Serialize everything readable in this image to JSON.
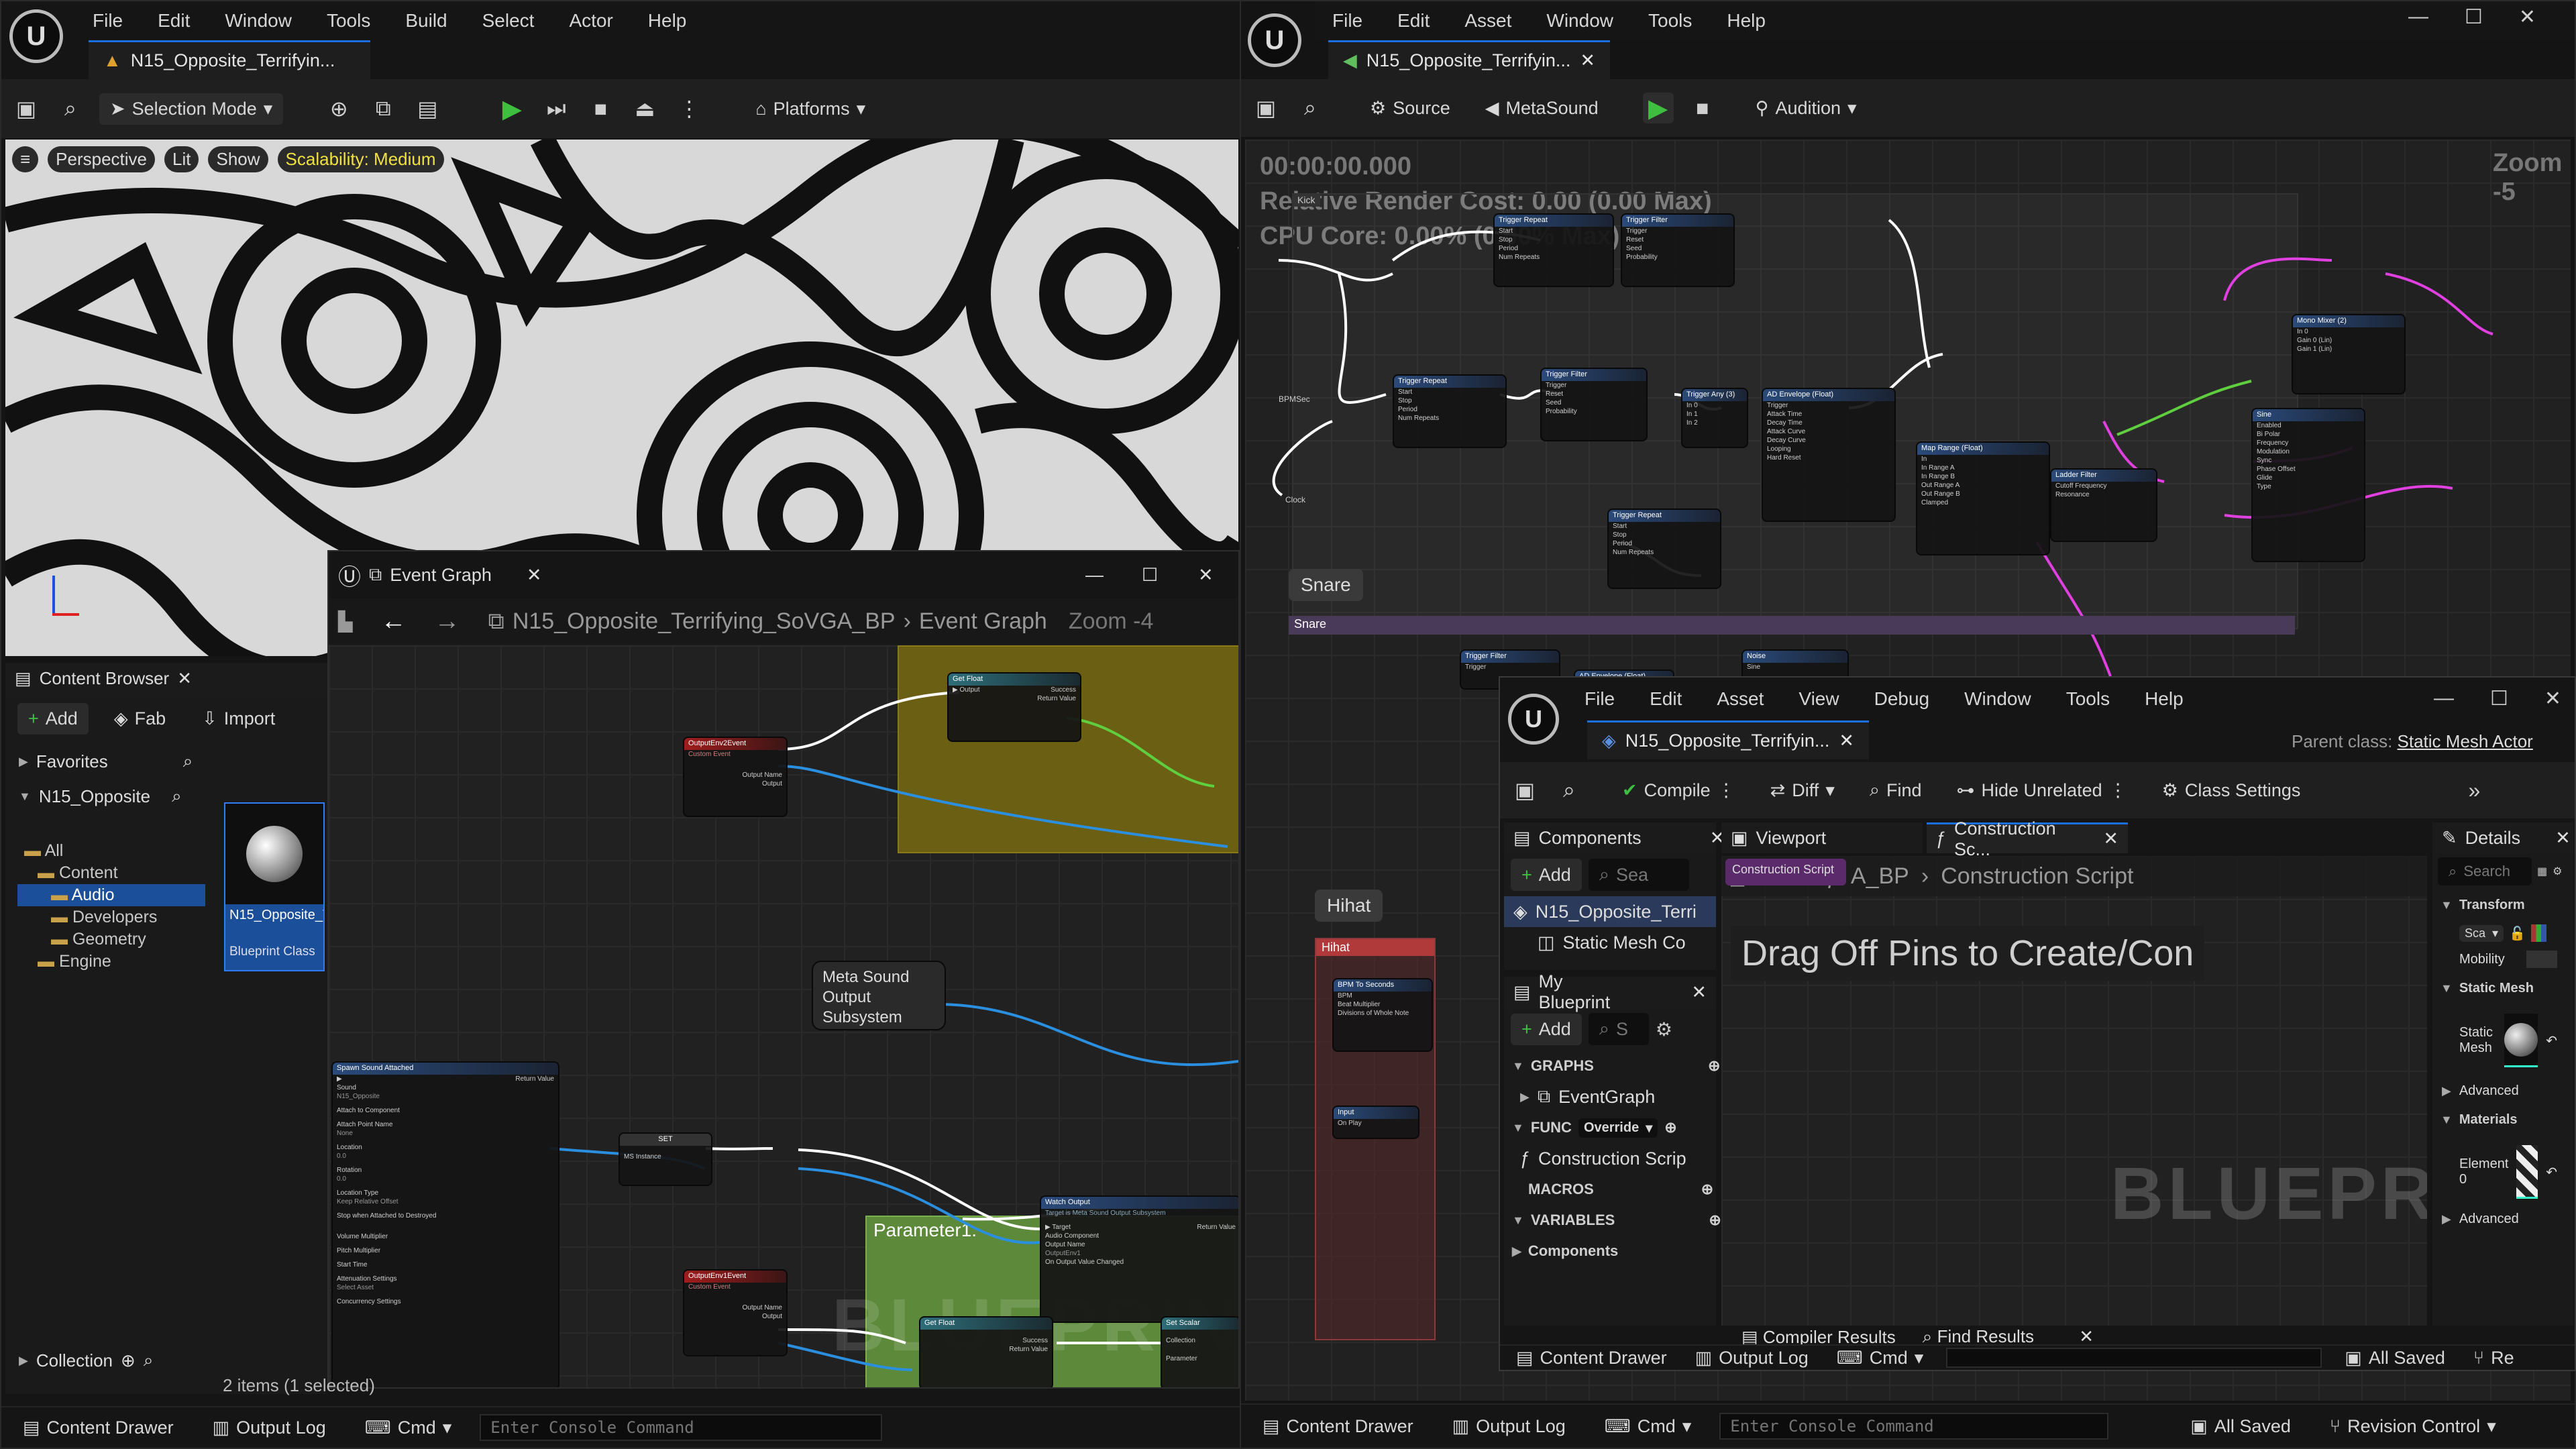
{
  "ue_main": {
    "menu": [
      "File",
      "Edit",
      "Window",
      "Tools",
      "Build",
      "Select",
      "Actor",
      "Help"
    ],
    "tab_title": "N15_Opposite_Terrifyin...",
    "toolbar": {
      "mode": "Selection Mode",
      "platforms": "Platforms"
    },
    "viewport": {
      "perspective": "Perspective",
      "lit": "Lit",
      "show": "Show",
      "scalability": "Scalability: Medium"
    },
    "content_browser": {
      "title": "Content Browser",
      "add": "Add",
      "fab": "Fab",
      "import": "Import",
      "favorites": "Favorites",
      "project": "N15_Opposite",
      "tree": [
        "All",
        "Content",
        "Audio",
        "Developers",
        "Geometry",
        "Engine"
      ],
      "asset_name": "N15_Opposite_Terrifying_So...",
      "asset_type": "Blueprint Class",
      "collections": "Collection",
      "items": "2 items (1 selected)"
    },
    "status": {
      "drawer": "Content Drawer",
      "log": "Output Log",
      "cmd": "Cmd",
      "console_placeholder": "Enter Console Command"
    }
  },
  "event_graph": {
    "tab": "Event Graph",
    "breadcrumb_bp": "N15_Opposite_Terrifying_SoVGA_BP",
    "breadcrumb_graph": "Event Graph",
    "zoom": "Zoom -4",
    "watermark": "BLUEPRINT",
    "comment_param": "Parameter1:",
    "nodes": {
      "get_float": "Get Float",
      "output_env2": "OutputEnv2Event",
      "custom_event": "Custom Event",
      "output_env1": "OutputEnv1Event",
      "spawn_sound": "Spawn Sound Attached",
      "set": "SET",
      "watch_output": "Watch Output",
      "watch_sub": "Target is Meta Sound Output Subsystem",
      "ms_subsystem": "Meta Sound Output Subsystem",
      "get_float2": "Get Float",
      "set_scalar": "Set Scalar"
    },
    "pins": {
      "output": "Output",
      "success": "Success",
      "return_value": "Return Value",
      "output_name": "Output Name",
      "sound": "Sound",
      "attach": "Attach to Component",
      "attach_point": "Attach Point Name",
      "location": "Location",
      "rotation": "Rotation",
      "location_type": "Location Type",
      "stop": "Stop when Attached to Destroyed",
      "volume": "Volume Multiplier",
      "pitch": "Pitch Multiplier",
      "start_time": "Start Time",
      "attenuation": "Attenuation Settings",
      "concurrency": "Concurrency Settings",
      "ms_instance": "MS Instance",
      "target": "Target",
      "audio_component": "Audio Component",
      "on_output": "On Output Value Changed",
      "output_env1_val": "OutputEnv1",
      "collection": "Collection",
      "parameter": "Parameter",
      "keep_relative": "Keep Relative Offset",
      "none": "None",
      "n15": "N15_Opposite",
      "one": "1.0",
      "zero": "0.0",
      "zero_a": "0.0",
      "select_asset": "Select Asset"
    }
  },
  "metasound": {
    "menu": [
      "File",
      "Edit",
      "Asset",
      "Window",
      "Tools",
      "Help"
    ],
    "tab_title": "N15_Opposite_Terrifyin...",
    "toolbar": {
      "source": "Source",
      "metasound": "MetaSound",
      "audition": "Audition"
    },
    "timer": "00:00:00.000",
    "render_cost": "Relative Render Cost: 0.00 (0.00 Max)",
    "cpu": "CPU Core: 0.00% (0.00% Max)",
    "zoom": "Zoom -5",
    "snare_label": "Snare",
    "snare_bar": "Snare",
    "hihat_label": "Hihat",
    "hihat_bar": "Hihat",
    "nodes": [
      "Trigger Repeat",
      "Trigger Filter",
      "Trigger Repeat",
      "Trigger Filter",
      "Trigger Any (3)",
      "AD Envelope (Float)",
      "Map Range (Float)",
      "Ladder Filter",
      "Mono Mixer (2)",
      "Sine",
      "Trigger Repeat",
      "BPM To Seconds",
      "Input",
      "Trigger Filter",
      "AD Envelope (Float)",
      "Noise"
    ],
    "pin_words": [
      "Start",
      "Stop",
      "Period",
      "Num Repeats",
      "Trigger",
      "Reset",
      "Seed",
      "Probability",
      "Heads",
      "Tails",
      "In 0",
      "In 1",
      "In 2",
      "Out",
      "Attack Time",
      "Decay Time",
      "Attack Curve",
      "Decay Curve",
      "Looping",
      "Hard Reset",
      "On Trigger",
      "On Done",
      "Out Envelope",
      "In",
      "In Range A",
      "In Range B",
      "Out Range A",
      "Out Range B",
      "Clamped",
      "Out Value",
      "Cutoff Frequency",
      "Resonance",
      "Audio",
      "Enabled",
      "Bi Polar",
      "Frequency",
      "Modulation",
      "Sync",
      "Phase Offset",
      "Glide",
      "Type",
      "In 0",
      "Gain 0 (Lin)",
      "Gain 1 (Lin)",
      "Out",
      "BPM",
      "Beat Multiplier",
      "Divisions of Whole Note",
      "Seconds",
      "On Play",
      "BPMSec",
      "Clock",
      "Kick",
      "Out",
      "Sine",
      "Seed",
      "Audio",
      "Trigger"
    ],
    "status": {
      "drawer": "Content Drawer",
      "log": "Output Log",
      "cmd": "Cmd",
      "console_placeholder": "Enter Console Command",
      "saved": "All Saved",
      "revision": "Revision Control"
    }
  },
  "bp_editor": {
    "menu": [
      "File",
      "Edit",
      "Asset",
      "View",
      "Debug",
      "Window",
      "Tools",
      "Help"
    ],
    "tab_title": "N15_Opposite_Terrifyin...",
    "parent_label": "Parent class:",
    "parent_value": "Static Mesh Actor",
    "toolbar": {
      "compile": "Compile",
      "diff": "Diff",
      "find": "Find",
      "hide": "Hide Unrelated",
      "class_settings": "Class Settings"
    },
    "components": {
      "title": "Components",
      "add": "Add",
      "search": "Sea",
      "root": "N15_Opposite_Terri",
      "child": "Static Mesh Co"
    },
    "my_blueprint": {
      "title": "My Blueprint",
      "add": "Add",
      "search": "S",
      "graphs": "GRAPHS",
      "event_graph": "EventGraph",
      "func": "FUNC",
      "override": "Override",
      "construction": "Construction Scrip",
      "macros": "MACROS",
      "variables": "VARIABLES",
      "comp": "Components"
    },
    "viewport_tab": "Viewport",
    "construction_tab": "Construction Sc...",
    "construction_tab_inner": "Construction Script",
    "bc_bp": "A_BP",
    "bc_cs": "Construction Script",
    "hint": "Drag Off Pins to Create/Con",
    "watermark": "BLUEPRINT",
    "details": {
      "title": "Details",
      "search": "Search",
      "transform": "Transform",
      "sca": "Sca",
      "mobility": "Mobility",
      "static_mesh_sec": "Static Mesh",
      "static_mesh": "Static Mesh",
      "advanced": "Advanced",
      "materials": "Materials",
      "element0": "Element 0",
      "advanced2": "Advanced"
    },
    "bottom": {
      "compiler": "Compiler Results",
      "find_results": "Find Results",
      "drawer": "Content Drawer",
      "log": "Output Log",
      "cmd": "Cmd",
      "saved": "All Saved",
      "re": "Re"
    }
  }
}
